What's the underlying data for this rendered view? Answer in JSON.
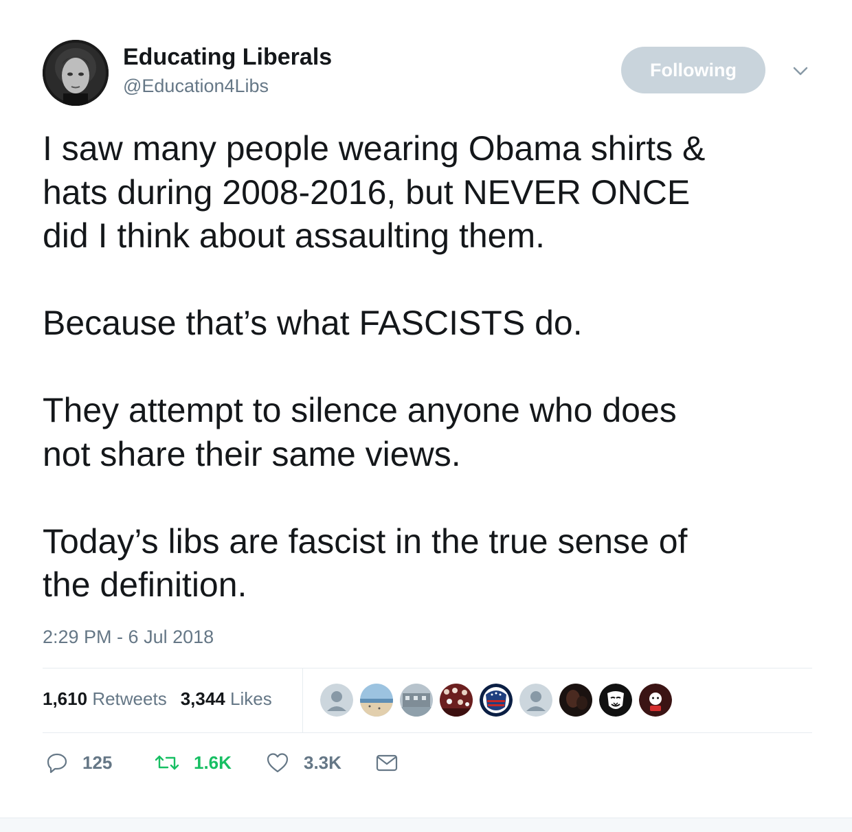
{
  "tweet": {
    "author": {
      "display_name": "Educating Liberals",
      "handle": "@Education4Libs"
    },
    "follow_button_label": "Following",
    "text_paragraphs": [
      [
        "I saw many people wearing Obama shirts &",
        "hats during 2008-2016, but NEVER ONCE",
        "did I think about assaulting them."
      ],
      [
        "Because that’s what FASCISTS do."
      ],
      [
        "They attempt to silence anyone who does",
        "not share their same views."
      ],
      [
        "Today’s libs are fascist in the true sense of",
        "the definition."
      ]
    ],
    "timestamp": "2:29 PM - 6 Jul 2018",
    "stats": {
      "retweets_count": "1,610",
      "retweets_label": "Retweets",
      "likes_count": "3,344",
      "likes_label": "Likes"
    },
    "liker_avatars": [
      "default-avatar",
      "beach-photo",
      "building-photo",
      "crowd-photo",
      "flag-logo",
      "default-avatar",
      "dark-photo",
      "mask-icon",
      "cartoon-photo"
    ],
    "actions": {
      "replies": "125",
      "retweets": "1.6K",
      "likes": "3.3K"
    }
  },
  "colors": {
    "text": "#14171a",
    "secondary": "#657786",
    "retweeted": "#17bf63",
    "follow_button": "#c9d4dc",
    "divider": "#e6ecf0"
  }
}
